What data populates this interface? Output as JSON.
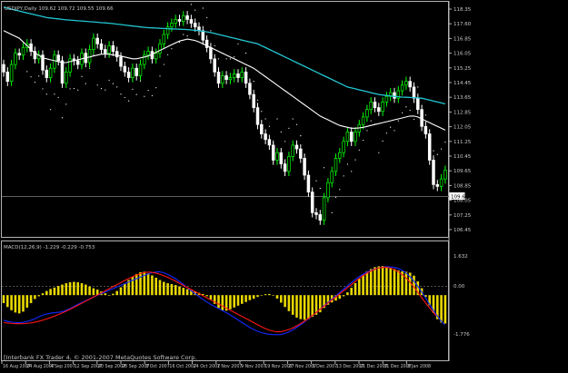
{
  "title": "USDJPY,Daily 109.62 109.72 109.55 109.66",
  "footer": "[Interbank FX Trader 4, © 2001-2007 MetaQuotes Software Corp.",
  "colors": {
    "background": "#000000",
    "frame": "#b4b4b4",
    "text": "#c8c8c8",
    "bull": "#00ff00",
    "bear": "#ffffff",
    "ma_fast": "#ffffff",
    "ma_slow": "#22c8d4",
    "sar": "#ffffff",
    "hist": "#e8d800",
    "macd": "#1428ff",
    "signal": "#ff1414",
    "price_box": "#ffffff"
  },
  "price_axis": {
    "ticks": [
      "118.35",
      "117.60",
      "116.85",
      "116.05",
      "115.25",
      "114.45",
      "113.65",
      "112.85",
      "112.05",
      "111.25",
      "110.45",
      "109.65",
      "108.85",
      "108.05",
      "107.25",
      "106.45"
    ],
    "current": "109.66"
  },
  "macd_axis": {
    "ticks": [
      "1.632",
      "0.00",
      "-1.776"
    ]
  },
  "time_labels": [
    "16 Aug 2007",
    "24 Aug 2007",
    "4 Sep 2007",
    "12 Sep 2007",
    "20 Sep 2007",
    "28 Sep 2007",
    "8 Oct 2007",
    "16 Oct 2007",
    "24 Oct 2007",
    "1 Nov 2007",
    "9 Nov 2007",
    "19 Nov 2007",
    "27 Nov 2007",
    "5 Dec 2007",
    "13 Dec 2007",
    "21 Dec 2007",
    "31 Dec 2007",
    "8 Jan 2008"
  ],
  "macd_label": "MACD(12,26,9) -1.229 -0.229 -0.753",
  "chart_data": {
    "type": "candlestick",
    "symbol": "USDJPY",
    "timeframe": "Daily",
    "x_range": [
      "16 Aug 2007",
      "8 Jan 2008"
    ],
    "y_range": [
      106.45,
      118.35
    ],
    "close": [
      114.9,
      114.4,
      115.3,
      115.9,
      115.8,
      116.2,
      116.4,
      116.0,
      115.6,
      115.8,
      115.0,
      114.6,
      115.1,
      115.8,
      115.5,
      114.3,
      114.9,
      115.6,
      115.5,
      115.3,
      115.9,
      115.4,
      116.1,
      116.7,
      116.4,
      116.1,
      115.9,
      116.3,
      116.0,
      115.7,
      115.2,
      114.9,
      114.6,
      115.1,
      114.7,
      115.3,
      115.8,
      116.0,
      115.6,
      115.9,
      116.4,
      116.9,
      117.3,
      117.5,
      117.7,
      117.6,
      117.9,
      117.7,
      117.5,
      117.3,
      117.1,
      116.6,
      116.2,
      115.6,
      114.9,
      114.3,
      114.7,
      114.5,
      114.6,
      114.8,
      114.6,
      114.9,
      114.3,
      113.7,
      113.0,
      112.1,
      111.6,
      111.3,
      111.0,
      110.2,
      110.6,
      110.0,
      109.6,
      110.4,
      111.0,
      110.8,
      110.3,
      109.4,
      108.5,
      107.4,
      107.3,
      107.0,
      108.2,
      109.0,
      109.6,
      110.3,
      110.6,
      111.2,
      111.7,
      111.2,
      111.7,
      112.1,
      112.5,
      112.9,
      113.3,
      113.0,
      112.8,
      113.3,
      113.6,
      113.8,
      113.5,
      113.9,
      114.2,
      114.4,
      114.1,
      113.5,
      112.9,
      112.0,
      111.6,
      110.2,
      108.9,
      108.8,
      109.2,
      109.66
    ],
    "ma_fast": [
      117.1,
      117.0,
      116.9,
      116.8,
      116.7,
      116.5,
      116.3,
      116.1,
      115.9,
      115.8,
      115.65,
      115.6,
      115.55,
      115.5,
      115.45,
      115.4,
      115.4,
      115.45,
      115.5,
      115.55,
      115.6,
      115.65,
      115.7,
      115.75,
      115.8,
      115.85,
      115.85,
      115.85,
      115.8,
      115.8,
      115.75,
      115.7,
      115.65,
      115.6,
      115.6,
      115.65,
      115.7,
      115.75,
      115.85,
      115.95,
      116.05,
      116.15,
      116.25,
      116.35,
      116.45,
      116.55,
      116.6,
      116.65,
      116.62,
      116.58,
      116.5,
      116.4,
      116.3,
      116.2,
      116.1,
      116.0,
      115.9,
      115.8,
      115.7,
      115.6,
      115.5,
      115.4,
      115.3,
      115.2,
      115.1,
      114.95,
      114.8,
      114.65,
      114.5,
      114.35,
      114.2,
      114.05,
      113.9,
      113.75,
      113.6,
      113.45,
      113.3,
      113.15,
      113.0,
      112.85,
      112.7,
      112.55,
      112.45,
      112.35,
      112.25,
      112.15,
      112.05,
      112.0,
      111.95,
      111.9,
      111.9,
      111.92,
      111.95,
      112.0,
      112.05,
      112.1,
      112.15,
      112.2,
      112.25,
      112.3,
      112.35,
      112.4,
      112.45,
      112.5,
      112.55,
      112.55,
      112.5,
      112.4,
      112.3,
      112.2,
      112.1,
      112.0,
      111.9,
      111.8
    ],
    "ma_slow": [
      118.35,
      118.3,
      118.25,
      118.2,
      118.15,
      118.1,
      118.05,
      118.0,
      117.95,
      117.9,
      117.85,
      117.8,
      117.78,
      117.75,
      117.73,
      117.7,
      117.68,
      117.67,
      117.65,
      117.63,
      117.62,
      117.6,
      117.58,
      117.57,
      117.55,
      117.53,
      117.52,
      117.5,
      117.48,
      117.45,
      117.43,
      117.4,
      117.38,
      117.35,
      117.33,
      117.3,
      117.28,
      117.26,
      117.25,
      117.24,
      117.23,
      117.22,
      117.21,
      117.2,
      117.19,
      117.18,
      117.17,
      117.16,
      117.14,
      117.12,
      117.1,
      117.07,
      117.04,
      117.0,
      116.95,
      116.9,
      116.85,
      116.8,
      116.75,
      116.7,
      116.65,
      116.6,
      116.55,
      116.5,
      116.45,
      116.4,
      116.3,
      116.2,
      116.1,
      116.0,
      115.9,
      115.8,
      115.7,
      115.6,
      115.5,
      115.4,
      115.3,
      115.2,
      115.1,
      115.0,
      114.9,
      114.8,
      114.7,
      114.6,
      114.5,
      114.4,
      114.3,
      114.2,
      114.1,
      114.05,
      114.0,
      113.95,
      113.9,
      113.85,
      113.8,
      113.75,
      113.7,
      113.67,
      113.65,
      113.62,
      113.6,
      113.58,
      113.56,
      113.55,
      113.54,
      113.53,
      113.52,
      113.5,
      113.45,
      113.4,
      113.35,
      113.3,
      113.25,
      113.2
    ],
    "macd_range": [
      -1.776,
      1.632
    ],
    "histogram": [
      -0.35,
      -0.52,
      -0.66,
      -0.76,
      -0.8,
      -0.72,
      -0.55,
      -0.35,
      -0.17,
      -0.05,
      0.08,
      0.18,
      0.27,
      0.33,
      0.4,
      0.46,
      0.52,
      0.56,
      0.58,
      0.56,
      0.52,
      0.46,
      0.38,
      0.3,
      0.24,
      0.16,
      0.08,
      -0.02,
      0.06,
      0.18,
      0.34,
      0.5,
      0.66,
      0.8,
      0.92,
      1.0,
      1.02,
      0.95,
      0.86,
      0.76,
      0.66,
      0.58,
      0.52,
      0.48,
      0.44,
      0.38,
      0.32,
      0.26,
      0.22,
      0.16,
      0.1,
      0.05,
      -0.05,
      -0.2,
      -0.38,
      -0.56,
      -0.66,
      -0.68,
      -0.62,
      -0.54,
      -0.46,
      -0.38,
      -0.3,
      -0.22,
      -0.16,
      -0.08,
      0.0,
      0.04,
      0.05,
      0.0,
      -0.15,
      -0.33,
      -0.52,
      -0.7,
      -0.86,
      -0.98,
      -1.05,
      -1.08,
      -1.05,
      -0.95,
      -0.86,
      -0.75,
      -0.56,
      -0.42,
      -0.32,
      -0.24,
      -0.16,
      -0.05,
      0.12,
      0.32,
      0.52,
      0.72,
      0.9,
      1.04,
      1.14,
      1.22,
      1.26,
      1.27,
      1.24,
      1.19,
      1.14,
      1.08,
      1.04,
      1.02,
      0.98,
      0.85,
      0.6,
      0.3,
      -0.08,
      -0.45,
      -0.78,
      -1.05,
      -1.2,
      -1.24
    ],
    "macd_line": [
      -1.1,
      -1.15,
      -1.18,
      -1.2,
      -1.2,
      -1.17,
      -1.12,
      -1.05,
      -0.96,
      -0.88,
      -0.82,
      -0.78,
      -0.76,
      -0.74,
      -0.7,
      -0.62,
      -0.52,
      -0.42,
      -0.33,
      -0.24,
      -0.15,
      -0.06,
      0.02,
      0.1,
      0.18,
      0.26,
      0.34,
      0.42,
      0.5,
      0.58,
      0.66,
      0.74,
      0.82,
      0.9,
      0.96,
      1.0,
      1.02,
      0.98,
      0.9,
      0.8,
      0.68,
      0.55,
      0.4,
      0.24,
      0.1,
      -0.04,
      -0.18,
      -0.3,
      -0.42,
      -0.52,
      -0.62,
      -0.72,
      -0.82,
      -0.94,
      -1.06,
      -1.18,
      -1.3,
      -1.42,
      -1.52,
      -1.6,
      -1.66,
      -1.7,
      -1.72,
      -1.73,
      -1.72,
      -1.68,
      -1.6,
      -1.5,
      -1.38,
      -1.25,
      -1.1,
      -0.95,
      -0.8,
      -0.64,
      -0.48,
      -0.32,
      -0.16,
      0.0,
      0.16,
      0.32,
      0.48,
      0.64,
      0.78,
      0.9,
      1.0,
      1.08,
      1.15,
      1.2,
      1.23,
      1.24,
      1.22,
      1.18,
      1.1,
      0.98,
      0.8,
      0.58,
      0.32,
      0.04,
      -0.26,
      -0.56,
      -0.84,
      -1.1,
      -1.3
    ],
    "signal_line": [
      -1.2,
      -1.22,
      -1.24,
      -1.25,
      -1.25,
      -1.24,
      -1.22,
      -1.19,
      -1.15,
      -1.1,
      -1.04,
      -0.97,
      -0.9,
      -0.82,
      -0.74,
      -0.65,
      -0.56,
      -0.46,
      -0.36,
      -0.26,
      -0.16,
      -0.06,
      0.04,
      0.14,
      0.24,
      0.34,
      0.44,
      0.54,
      0.64,
      0.73,
      0.82,
      0.9,
      0.96,
      1.0,
      1.0,
      0.97,
      0.92,
      0.85,
      0.77,
      0.68,
      0.58,
      0.48,
      0.38,
      0.28,
      0.18,
      0.08,
      -0.02,
      -0.12,
      -0.22,
      -0.32,
      -0.42,
      -0.52,
      -0.62,
      -0.72,
      -0.82,
      -0.92,
      -1.02,
      -1.12,
      -1.22,
      -1.32,
      -1.42,
      -1.5,
      -1.56,
      -1.6,
      -1.6,
      -1.56,
      -1.5,
      -1.42,
      -1.32,
      -1.2,
      -1.08,
      -0.94,
      -0.8,
      -0.65,
      -0.5,
      -0.35,
      -0.2,
      -0.05,
      0.1,
      0.25,
      0.4,
      0.55,
      0.7,
      0.84,
      0.96,
      1.06,
      1.14,
      1.2,
      1.22,
      1.2,
      1.14,
      1.05,
      0.92,
      0.76,
      0.56,
      0.32,
      0.06,
      -0.2,
      -0.45,
      -0.68,
      -0.9
    ]
  }
}
